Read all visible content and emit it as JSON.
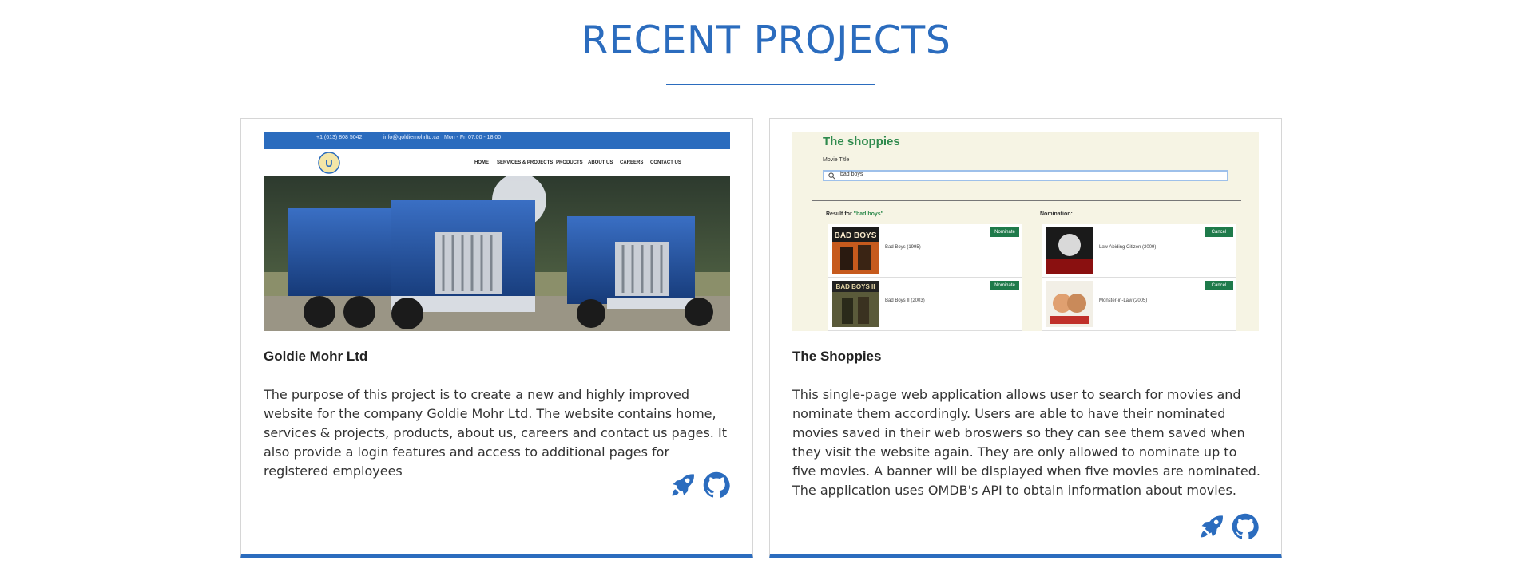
{
  "section": {
    "title": "RECENT PROJECTS"
  },
  "colors": {
    "accent": "#2b6cbe",
    "shoppies_green": "#2f8a4d",
    "nominate_button": "#1e7a4a"
  },
  "projects": [
    {
      "name": "Goldie Mohr Ltd",
      "description": "The purpose of this project is to create a new and highly improved website for the company Goldie Mohr Ltd. The website contains home, services & projects, products, about us, careers and contact us pages. It also provide a login features and access to additional pages for registered employees",
      "links": [
        {
          "icon": "rocket-icon"
        },
        {
          "icon": "github-icon"
        }
      ],
      "thumbnail": {
        "topbar": [
          "+1 (613) 808 5042",
          "info@goldiemohrltd.ca",
          "Mon - Fri 07:00 - 18:00"
        ],
        "menu": [
          "HOME",
          "SERVICES & PROJECTS",
          "PRODUCTS",
          "ABOUT US",
          "CAREERS",
          "CONTACT US"
        ]
      }
    },
    {
      "name": "The Shoppies",
      "description": "This single-page web application allows user to search for movies and nominate them accordingly. Users are able to have their nominated movies saved in their web broswers so they can see them saved when they visit the website again. They are only allowed to nominate up to five movies. A banner will be displayed when five movies are nominated. The application uses OMDB's API to obtain information about movies.",
      "links": [
        {
          "icon": "rocket-icon"
        },
        {
          "icon": "github-icon"
        }
      ],
      "thumbnail": {
        "title": "The shoppies",
        "field_label": "Movie Title",
        "search_value": "bad boys",
        "results_heading_prefix": "Result for ",
        "results_query": "\"bad boys\"",
        "nomination_heading": "Nomination:",
        "results": [
          {
            "title": "Bad Boys (1995)",
            "button": "Nominate"
          },
          {
            "title": "Bad Boys II (2003)",
            "button": "Nominate"
          }
        ],
        "nominations": [
          {
            "title": "Law Abiding Citizen (2009)",
            "button": "Cancel"
          },
          {
            "title": "Monster-in-Law (2005)",
            "button": "Cancel"
          }
        ]
      }
    }
  ]
}
